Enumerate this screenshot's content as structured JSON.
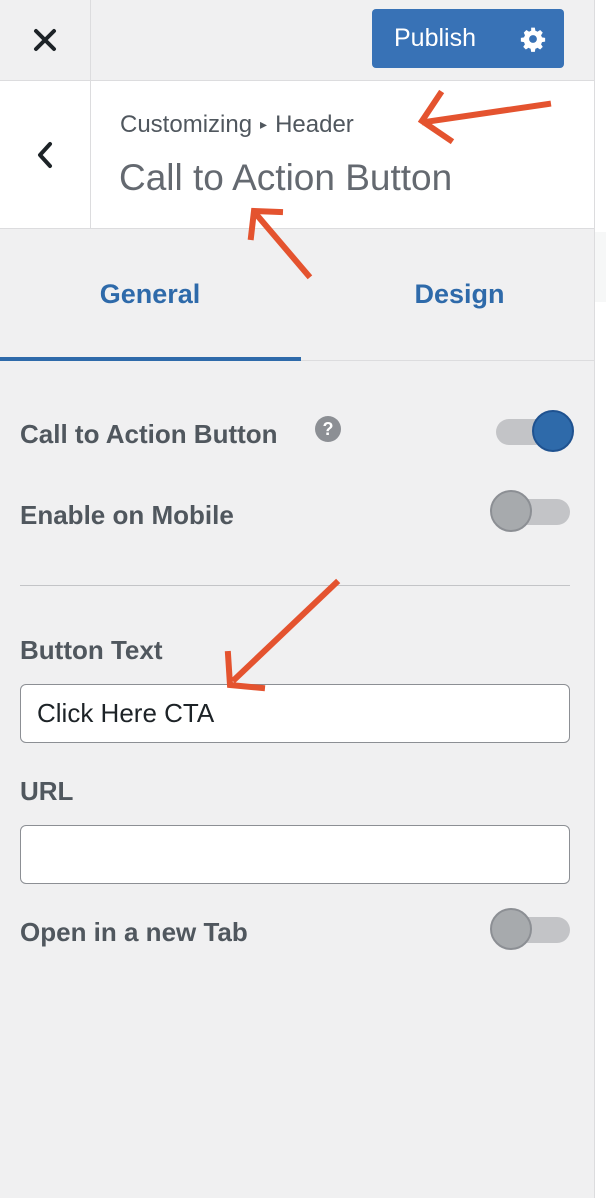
{
  "topbar": {
    "close_icon": "close-icon",
    "publish_label": "Publish",
    "settings_icon": "gear-icon"
  },
  "section": {
    "back_icon": "chevron-left-icon",
    "breadcrumb_root": "Customizing",
    "breadcrumb_separator": "▸",
    "breadcrumb_current": "Header",
    "title": "Call to Action Button"
  },
  "tabs": [
    {
      "label": "General",
      "active": true
    },
    {
      "label": "Design",
      "active": false
    }
  ],
  "controls": {
    "cta_toggle": {
      "label": "Call to Action Button",
      "help_icon": "help-icon",
      "help_glyph": "?",
      "enabled": true
    },
    "mobile_toggle": {
      "label": "Enable on Mobile",
      "enabled": false
    },
    "button_text": {
      "label": "Button Text",
      "value": "Click Here CTA"
    },
    "url": {
      "label": "URL",
      "value": ""
    },
    "new_tab_toggle": {
      "label": "Open in a new Tab",
      "enabled": false
    }
  },
  "colors": {
    "accent": "#2e6aaa",
    "publish_bg": "#3872b6",
    "annotation_arrow": "#e4532f",
    "panel_bg": "#f0f0f1"
  }
}
